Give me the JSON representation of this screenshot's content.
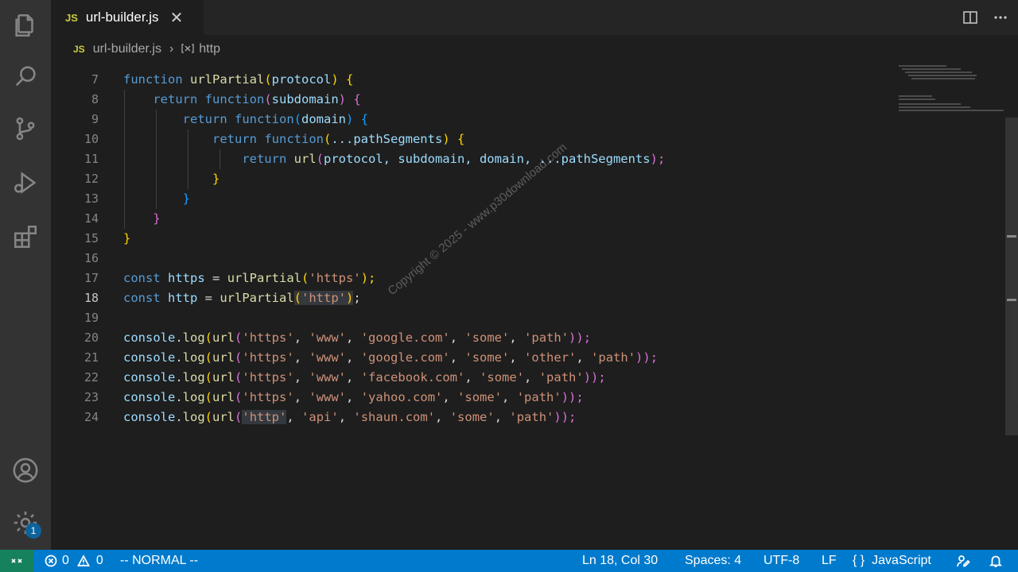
{
  "tab": {
    "lang_mark": "JS",
    "title": "url-builder.js",
    "close_glyph": "✕"
  },
  "breadcrumb": {
    "lang_mark": "JS",
    "file": "url-builder.js",
    "separator": "›",
    "symbol_icon": "symbol-variable-icon",
    "symbol": "http"
  },
  "activity_bar": {
    "items": [
      "files-icon",
      "search-icon",
      "source-control-icon",
      "run-debug-icon",
      "extensions-icon",
      "account-icon",
      "settings-gear-icon"
    ],
    "settings_badge": "1"
  },
  "editor": {
    "line_numbers": [
      "7",
      "8",
      "9",
      "10",
      "11",
      "12",
      "13",
      "14",
      "15",
      "16",
      "17",
      "18",
      "19",
      "20",
      "21",
      "22",
      "23",
      "24"
    ],
    "active_line": "18",
    "lines": {
      "l7": [
        "function",
        "urlPartial",
        "(",
        "protocol",
        ")",
        "{"
      ],
      "l8": [
        "return",
        "function",
        "(",
        "subdomain",
        ")",
        "{"
      ],
      "l9": [
        "return",
        "function",
        "(",
        "domain",
        ")",
        "{"
      ],
      "l10": [
        "return",
        "function",
        "(",
        "...pathSegments",
        ")",
        "{"
      ],
      "l11": [
        "return",
        "url",
        "(",
        "protocol, subdomain, domain, ...pathSegments",
        ");"
      ],
      "l12": [
        "}"
      ],
      "l13": [
        "}"
      ],
      "l14": [
        "}"
      ],
      "l15": [
        "}"
      ],
      "l17": [
        "const",
        "https",
        " = ",
        "urlPartial",
        "(",
        "'https'",
        ");"
      ],
      "l18": [
        "const",
        "http",
        " = ",
        "urlPartial",
        "(",
        "'http'",
        ")",
        ";"
      ],
      "l20": [
        "console",
        ".",
        "log",
        "(",
        "url",
        "(",
        "'https'",
        ", ",
        "'www'",
        ", ",
        "'google.com'",
        ", ",
        "'some'",
        ", ",
        "'path'",
        "));"
      ],
      "l21": [
        "console",
        ".",
        "log",
        "(",
        "url",
        "(",
        "'https'",
        ", ",
        "'www'",
        ", ",
        "'google.com'",
        ", ",
        "'some'",
        ", ",
        "'other'",
        ", ",
        "'path'",
        "));"
      ],
      "l22": [
        "console",
        ".",
        "log",
        "(",
        "url",
        "(",
        "'https'",
        ", ",
        "'www'",
        ", ",
        "'facebook.com'",
        ", ",
        "'some'",
        ", ",
        "'path'",
        "));"
      ],
      "l23": [
        "console",
        ".",
        "log",
        "(",
        "url",
        "(",
        "'https'",
        ", ",
        "'www'",
        ", ",
        "'yahoo.com'",
        ", ",
        "'some'",
        ", ",
        "'path'",
        "));"
      ],
      "l24": [
        "console",
        ".",
        "log",
        "(",
        "url",
        "(",
        "'http'",
        ", ",
        "'api'",
        ", ",
        "'shaun.com'",
        ", ",
        "'some'",
        ", ",
        "'path'",
        "));"
      ]
    }
  },
  "watermark": "Copyright © 2025 - www.p30download.com",
  "status_bar": {
    "errors": "0",
    "warnings": "0",
    "mode": "-- NORMAL --",
    "position": "Ln 18, Col 30",
    "indentation": "Spaces: 4",
    "encoding": "UTF-8",
    "eol": "LF",
    "language_glyph": "{ }",
    "language": "JavaScript"
  },
  "colors": {
    "keyword": "#569cd6",
    "function": "#dcdcaa",
    "parameter": "#9cdcfe",
    "string": "#ce9178",
    "status_bar": "#007acc",
    "remote_indicator": "#16825d"
  }
}
